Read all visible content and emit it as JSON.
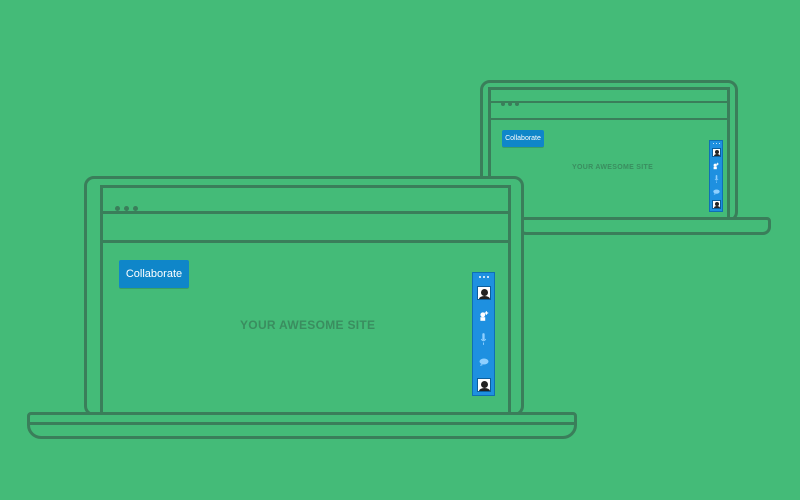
{
  "collaborate_label": "Collaborate",
  "site_label_large": "YOUR AWESOME SITE",
  "site_label_small": "YOUR AWESOME SITE",
  "colors": {
    "background": "#44bb78",
    "outline": "#3a7e5a",
    "button": "#0f86c9",
    "toolbar": "#1e90e0"
  },
  "toolbar_icons": [
    "user-avatar-icon",
    "add-user-icon",
    "microphone-icon",
    "chat-icon",
    "user-avatar-icon"
  ]
}
